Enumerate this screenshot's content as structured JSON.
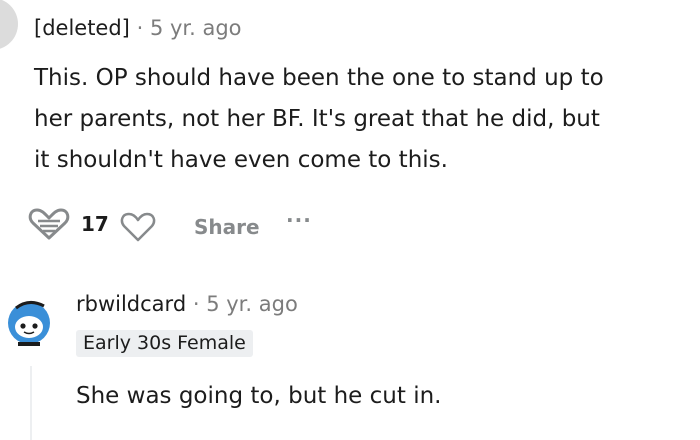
{
  "comment1": {
    "username": "[deleted]",
    "separator": "·",
    "timestamp": "5 yr. ago",
    "body_lines": [
      "This. OP should have been the one to stand up to",
      "her parents, not her BF. It's great that he did, but",
      "it shouldn't have even come to this."
    ],
    "actions": {
      "upvote_icon": "award-heart-icon",
      "vote_count": "17",
      "downvote_icon": "heart-outline-icon",
      "share_label": "Share",
      "more_label": "···"
    }
  },
  "comment2": {
    "username": "rbwildcard",
    "separator": "·",
    "timestamp": "5 yr. ago",
    "flair": "Early 30s Female",
    "avatar_icon": "snoo-avatar-icon",
    "body": "She was going to, but he cut in."
  },
  "colors": {
    "text": "#1c1c1c",
    "meta": "#7c7c7c",
    "action": "#878a8c",
    "flair_bg": "#edeff1"
  }
}
